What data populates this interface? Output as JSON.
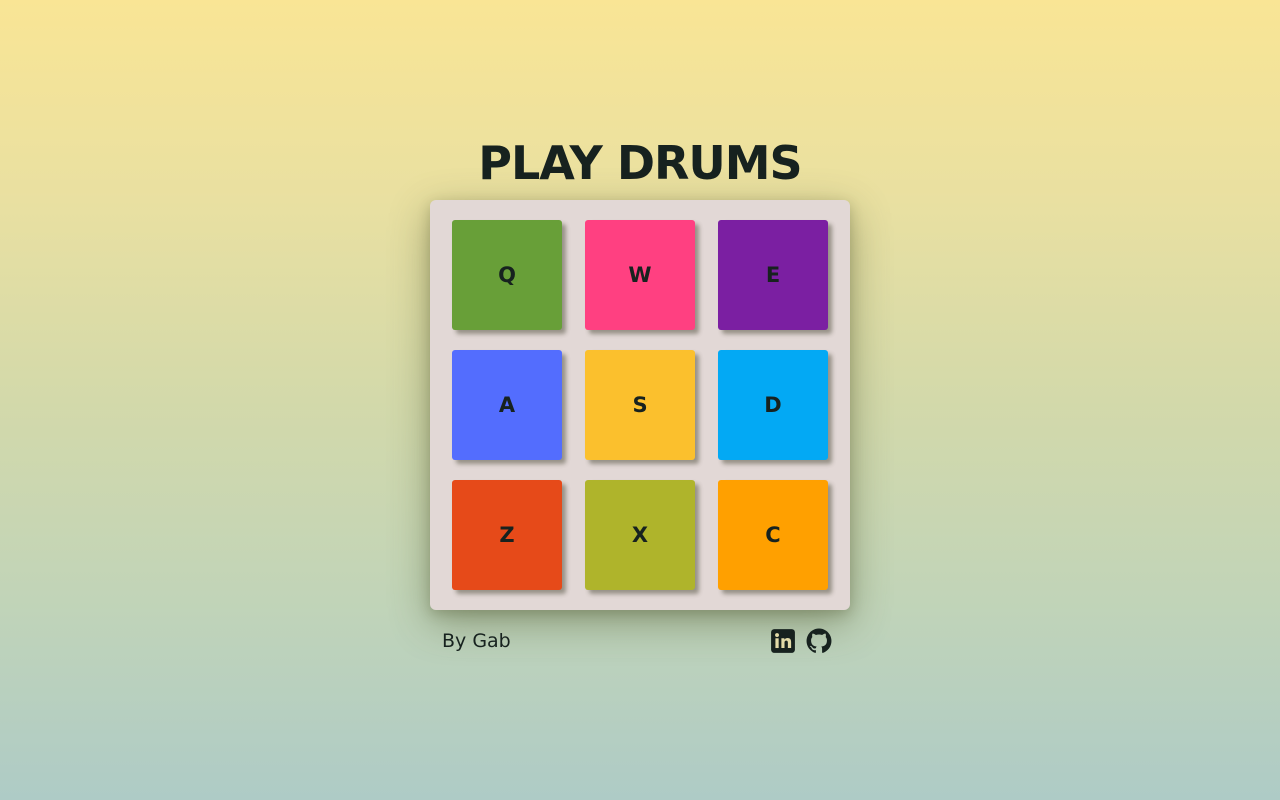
{
  "header": {
    "title": "PLAY DRUMS"
  },
  "pads": [
    {
      "key": "Q",
      "color": "#689f38"
    },
    {
      "key": "W",
      "color": "#ff4081"
    },
    {
      "key": "E",
      "color": "#7b1fa2"
    },
    {
      "key": "A",
      "color": "#536dfe"
    },
    {
      "key": "S",
      "color": "#fbc02d"
    },
    {
      "key": "D",
      "color": "#03a9f4"
    },
    {
      "key": "Z",
      "color": "#e64a19"
    },
    {
      "key": "X",
      "color": "#afb42b"
    },
    {
      "key": "C",
      "color": "#ffa000"
    }
  ],
  "footer": {
    "author": "By Gab",
    "links": [
      {
        "icon": "linkedin-icon"
      },
      {
        "icon": "github-icon"
      }
    ]
  }
}
